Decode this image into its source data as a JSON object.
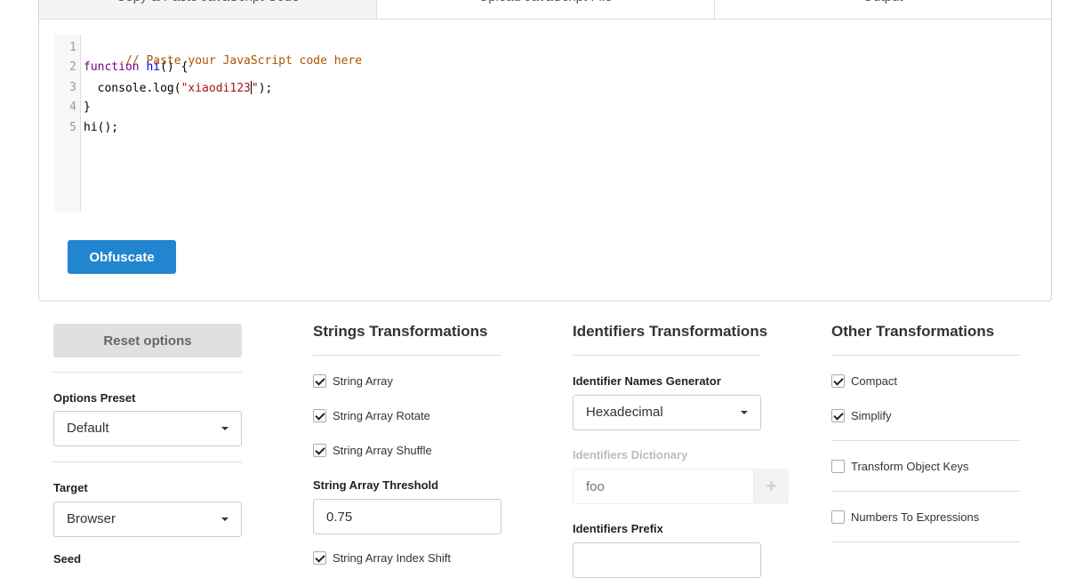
{
  "tabs": [
    "Copy & Paste JavaScript Code",
    "Upload JavaScript File",
    "Output"
  ],
  "editor": {
    "line_numbers": [
      "1",
      "2",
      "3",
      "4",
      "5"
    ],
    "comment": "// Paste your JavaScript code here",
    "kw_function": "function",
    "fn_name": "hi",
    "line2_rest": "() {",
    "line3_prefix": "  console.log(",
    "line3_string_a": "\"xiaodi123",
    "line3_string_b": "\"",
    "line3_suffix": ");",
    "line4": "}",
    "line5": "hi();"
  },
  "obfuscate_button": "Obfuscate",
  "reset_button": "Reset options",
  "options_preset": {
    "label": "Options Preset",
    "value": "Default"
  },
  "target": {
    "label": "Target",
    "value": "Browser"
  },
  "seed_label_partial": "Seed",
  "strings": {
    "heading": "Strings Transformations",
    "string_array": {
      "label": "String Array",
      "checked": true
    },
    "string_array_rotate": {
      "label": "String Array Rotate",
      "checked": true
    },
    "string_array_shuffle": {
      "label": "String Array Shuffle",
      "checked": true
    },
    "threshold_label": "String Array Threshold",
    "threshold_value": "0.75",
    "index_shift": {
      "label": "String Array Index Shift",
      "checked": true
    }
  },
  "identifiers": {
    "heading": "Identifiers Transformations",
    "generator_label": "Identifier Names Generator",
    "generator_value": "Hexadecimal",
    "dictionary_label": "Identifiers Dictionary",
    "dictionary_placeholder": "foo",
    "add_symbol": "+",
    "prefix_label": "Identifiers Prefix"
  },
  "other": {
    "heading": "Other Transformations",
    "compact": {
      "label": "Compact",
      "checked": true
    },
    "simplify": {
      "label": "Simplify",
      "checked": true
    },
    "transform_object_keys": {
      "label": "Transform Object Keys",
      "checked": false
    },
    "numbers_to_expressions": {
      "label": "Numbers To Expressions",
      "checked": false
    }
  },
  "colors": {
    "primary": "#2185d0",
    "reset_bg": "#e0e0e0"
  }
}
